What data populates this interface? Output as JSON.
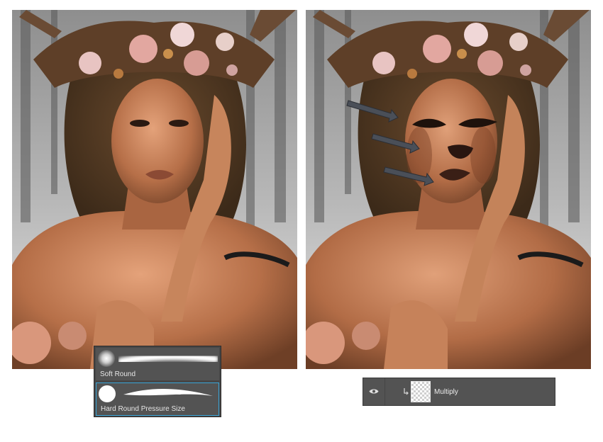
{
  "brush_presets": {
    "items": [
      {
        "label": "Soft Round",
        "selected": false
      },
      {
        "label": "Hard Round Pressure Size",
        "selected": true
      }
    ]
  },
  "layers_panel": {
    "layer": {
      "name": "Multiply",
      "visible": true,
      "clipped": true
    }
  },
  "colors": {
    "panel_bg": "#535353",
    "selection": "#39a5d8",
    "arrow": "#4a4f58",
    "makeup": "#3a1f16"
  }
}
